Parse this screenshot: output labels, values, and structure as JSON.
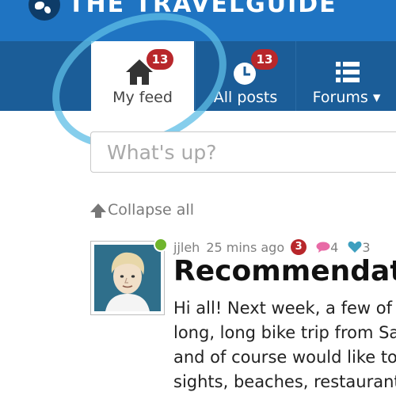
{
  "brand": {
    "name": "THE TRAVELGUIDE",
    "logo_icon": "globe-icon"
  },
  "nav": {
    "tabs": [
      {
        "label": "My feed",
        "icon": "home-icon",
        "badge": "13",
        "active": true
      },
      {
        "label": "All posts",
        "icon": "clock-icon",
        "badge": "13",
        "active": false
      },
      {
        "label": "Forums",
        "icon": "list-icon",
        "badge": "",
        "active": false
      }
    ],
    "forums_caret": "▾"
  },
  "search": {
    "placeholder": "What's up?",
    "value": ""
  },
  "feed": {
    "collapse_label": "Collapse all"
  },
  "post": {
    "author": "jjleh",
    "time": "25 mins ago",
    "notification_count": "3",
    "comment_count": "4",
    "like_count": "3",
    "title": "Recommendatio",
    "body_lines": [
      "Hi all! Next week, a few of m",
      "long, long bike trip from Sa",
      "and of course would like to",
      "sights, beaches, restaurants"
    ]
  },
  "colors": {
    "brand_bar": "#1f74c2",
    "nav_bar": "#1b5d98",
    "badge": "#b8272b",
    "online": "#6fb52c",
    "highlight_ring": "#5dbee6",
    "comment_icon": "#e86aa6",
    "like_icon": "#3d9fbf"
  }
}
